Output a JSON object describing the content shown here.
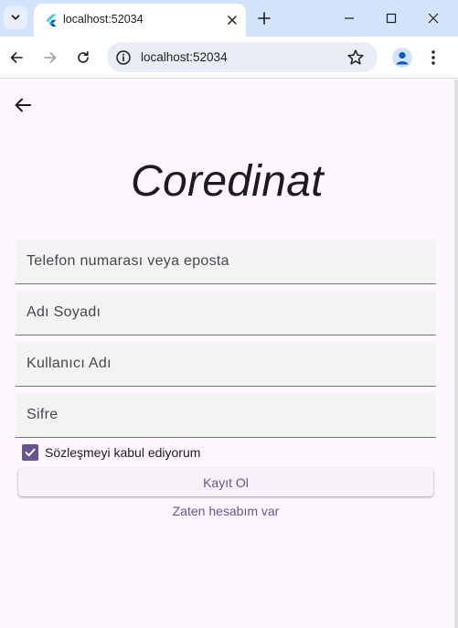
{
  "browser": {
    "tab": {
      "title": "localhost:52034",
      "favicon": "flutter-icon"
    },
    "address_bar": {
      "url": "localhost:52034"
    },
    "icons": {
      "tab_search": "chevron-down-icon",
      "tab_close": "close-icon",
      "new_tab": "plus-icon",
      "minimize": "minimize-icon",
      "maximize": "maximize-icon",
      "close": "close-icon",
      "back": "arrow-back-icon",
      "forward": "arrow-forward-icon",
      "reload": "reload-icon",
      "site_info": "info-icon",
      "bookmark": "star-icon",
      "profile": "profile-icon",
      "menu": "kebab-menu-icon"
    }
  },
  "app": {
    "back_icon": "arrow-back-icon",
    "title": "Coredinat",
    "fields": {
      "contact": {
        "placeholder": "Telefon numarası veya eposta",
        "value": ""
      },
      "full_name": {
        "placeholder": "Adı Soyadı",
        "value": ""
      },
      "username": {
        "placeholder": "Kullanıcı Adı",
        "value": ""
      },
      "password": {
        "placeholder": "Sifre",
        "value": ""
      }
    },
    "agreement": {
      "label": "Sözleşmeyi kabul ediyorum",
      "checked": true
    },
    "register_button": "Kayıt Ol",
    "login_link": "Zaten hesabım var"
  },
  "colors": {
    "primary": "#65558f",
    "background": "#fdf7ff",
    "field_fill": "#f3f3f3",
    "tabstrip": "#d3e3fd"
  }
}
